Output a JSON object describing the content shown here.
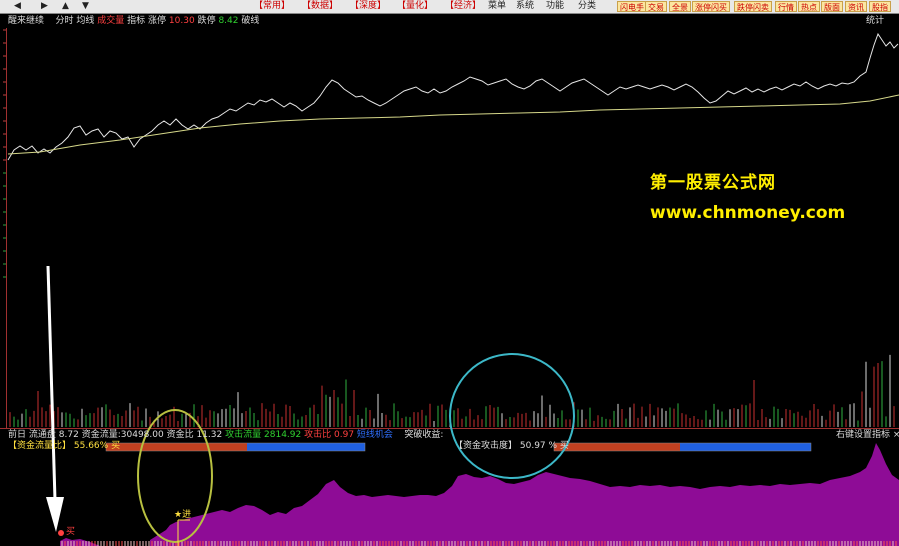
{
  "toolbar": {
    "nav_buttons": [
      "◀",
      "▶",
      "▲",
      "▼"
    ],
    "tabs": [
      "【常用】",
      "【数据】",
      "【深度】",
      "【量化】",
      "【经济】"
    ],
    "menus": [
      "菜单",
      "系统",
      "功能",
      "分类"
    ],
    "right_buttons": [
      "闪电手",
      "交易",
      "全景",
      "涨停闪买",
      "跌停闪卖",
      "行情",
      "热点",
      "版面",
      "资讯",
      "股指"
    ]
  },
  "chart_header": {
    "title": "醒来继续",
    "items": [
      "分时",
      "均线",
      "成交量",
      "指标"
    ],
    "limit_up_label": "涨停",
    "limit_up_value": "10.30",
    "limit_down_label": "跌停",
    "limit_down_value": "8.42",
    "extra": "破线",
    "stats": "统计"
  },
  "watermark": {
    "line1": "第一股票公式网",
    "line2": "www.chnmoney.com"
  },
  "indicator_bar": {
    "prefix": "前日",
    "float_label": "流通盘",
    "float_value": "8.72",
    "flow_label": "资金流量",
    "flow_value": "30498.00",
    "ratio_label": "资金比",
    "ratio_value": "11.32",
    "attack_flow_label": "攻击流量",
    "attack_flow_value": "2814.92",
    "attack_ratio_label": "攻击比",
    "attack_ratio_value": "0.97",
    "status": "短线机会",
    "breakout": "突破收益",
    "right_text": "右键设置指标",
    "close": "×"
  },
  "capital_line": {
    "left_label": "【资金流量比】",
    "left_value": "55.66% 买",
    "right_label": "【资金攻击度】",
    "right_value": "50.97 % 买"
  },
  "signals": {
    "s1": "买",
    "s2": "★进"
  },
  "colors": {
    "accent": "#ff4040",
    "magenta": "#8e0c96",
    "cyan": "#3cb8c8",
    "olive": "#b8c040",
    "blue": "#2060e0",
    "orange": "#c04020"
  }
}
